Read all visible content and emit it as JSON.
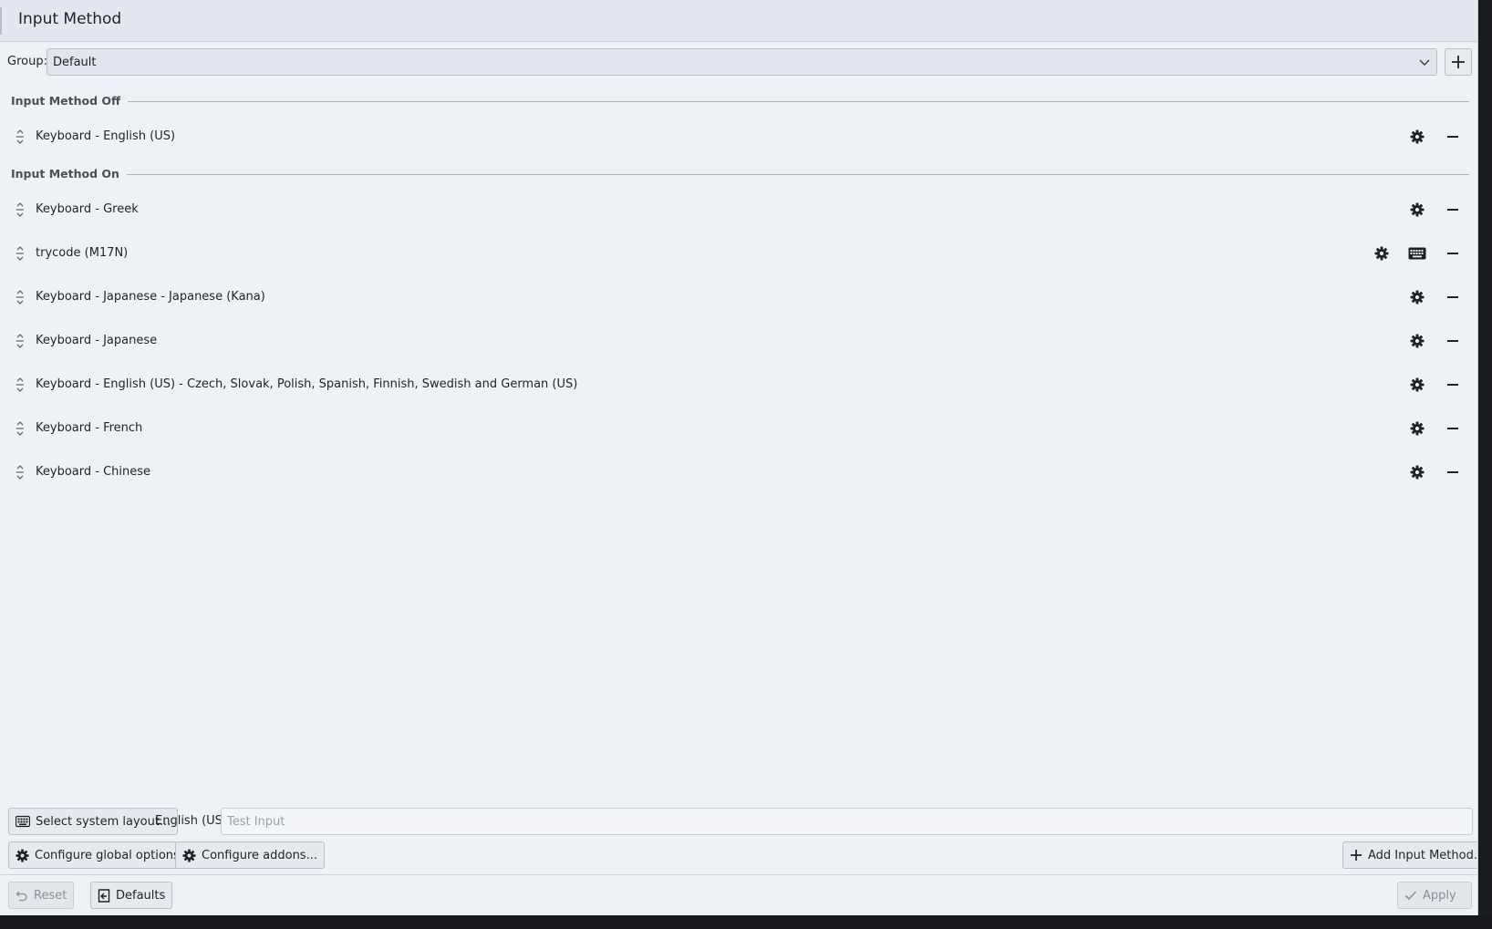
{
  "window": {
    "title": "Input Method"
  },
  "group": {
    "label": "Group:",
    "selected": "Default"
  },
  "sections": {
    "off": {
      "header": "Input Method Off",
      "items": [
        {
          "name": "Keyboard - English (US)"
        }
      ]
    },
    "on": {
      "header": "Input Method On",
      "items": [
        {
          "name": "Keyboard - Greek"
        },
        {
          "name": "trycode (M17N)"
        },
        {
          "name": "Keyboard - Japanese - Japanese (Kana)"
        },
        {
          "name": "Keyboard - Japanese"
        },
        {
          "name": "Keyboard - English (US) - Czech, Slovak, Polish, Spanish, Finnish, Swedish and German (US)"
        },
        {
          "name": "Keyboard - French"
        },
        {
          "name": "Keyboard - Chinese"
        }
      ]
    }
  },
  "bottom": {
    "select_layout": "Select system layout...",
    "current_layout": "English (US)",
    "test_input_placeholder": "Test Input",
    "configure_global": "Configure global options...",
    "configure_addons": "Configure addons...",
    "add_input_method": "Add Input Method..."
  },
  "footer": {
    "reset": "Reset",
    "defaults": "Defaults",
    "apply": "Apply"
  },
  "icons": {
    "gear": "gear-icon",
    "minus": "minus-icon",
    "keyboard": "keyboard-icon",
    "drag": "drag-handle-icon",
    "plus": "plus-icon"
  }
}
